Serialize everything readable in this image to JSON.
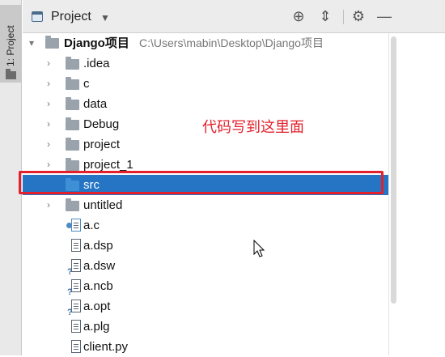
{
  "leftbar": {
    "tab_label": "1: Project",
    "icon": "folder-icon"
  },
  "header": {
    "title": "Project",
    "caret": "▼",
    "buttons": [
      {
        "name": "locate-icon",
        "glyph": "⊕"
      },
      {
        "name": "collapse-all-icon",
        "glyph": "⇕"
      },
      {
        "name": "gear-icon",
        "glyph": "⚙"
      },
      {
        "name": "minimize-icon",
        "glyph": "—"
      }
    ]
  },
  "tree": {
    "root": {
      "label": "Django项目",
      "path": "C:\\Users\\mabin\\Desktop\\Django项目"
    },
    "folders": [
      ".idea",
      "c",
      "data",
      "Debug",
      "project",
      "project_1",
      "src",
      "untitled"
    ],
    "selected": "src",
    "files": [
      "a.c",
      "a.dsp",
      "a.dsw",
      "a.ncb",
      "a.opt",
      "a.plg",
      "client.py"
    ]
  },
  "annotation": {
    "text": "代码写到这里面",
    "color": "#e3202b"
  },
  "colors": {
    "selection": "#2575c4",
    "highlight_frame": "#e3202b",
    "folder": "#9aa3ab"
  }
}
